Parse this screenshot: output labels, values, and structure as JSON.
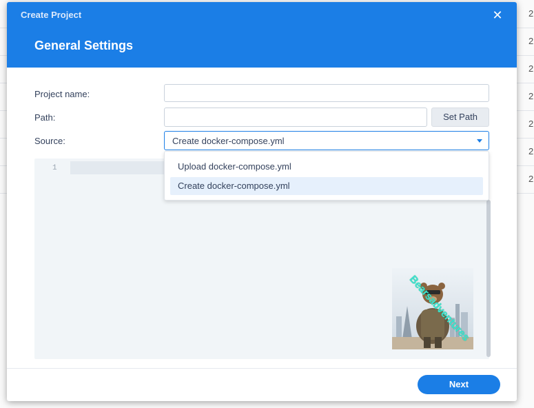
{
  "background": {
    "row_values": [
      "2",
      "2",
      "2",
      "2",
      "2",
      "2",
      "2"
    ]
  },
  "dialog": {
    "title": "Create Project",
    "close_icon": "close-icon",
    "section_title": "General Settings",
    "fields": {
      "project_name_label": "Project name:",
      "project_name_value": "",
      "path_label": "Path:",
      "path_value": "",
      "set_path_label": "Set Path",
      "source_label": "Source:",
      "source_value": "Create docker-compose.yml"
    },
    "source_options": [
      "Upload docker-compose.yml",
      "Create docker-compose.yml"
    ],
    "editor": {
      "line_number": "1"
    },
    "watermark_text": "Bearsadventures",
    "next_label": "Next"
  },
  "colors": {
    "accent": "#1b7ee6",
    "header_bg": "#1b7ee6",
    "editor_bg": "#f1f5f8",
    "selected_option_bg": "#e6f0fc"
  }
}
